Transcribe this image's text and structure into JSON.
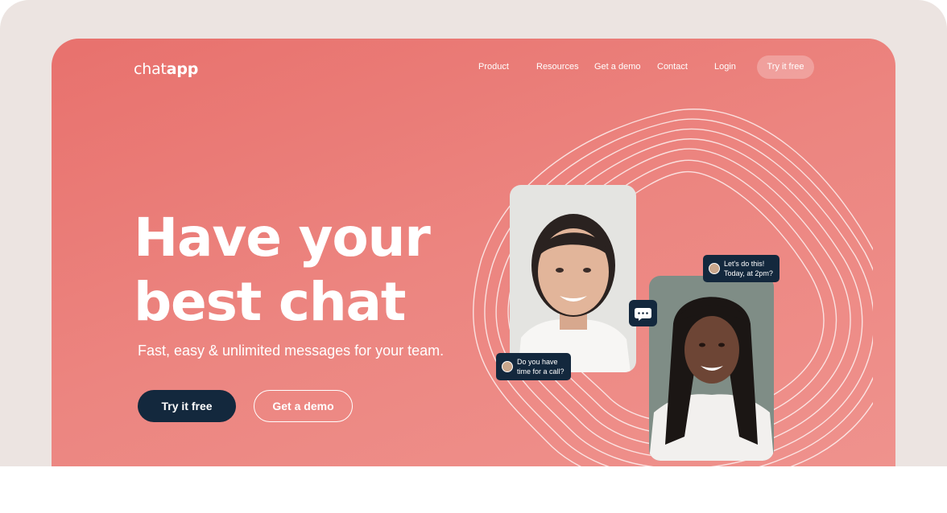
{
  "logo": {
    "light": "chat",
    "bold": "app"
  },
  "nav": {
    "items": [
      "Product",
      "Resources",
      "Get a demo",
      "Contact",
      "Login"
    ],
    "cta": "Try it free"
  },
  "hero": {
    "headline_line1": "Have your",
    "headline_line2": "best chat",
    "subline": "Fast, easy & unlimited messages for your team.",
    "primary_button": "Try it free",
    "secondary_button": "Get a demo"
  },
  "bubbles": {
    "top": {
      "line1": "Let's do this!",
      "line2": "Today, at 2pm?"
    },
    "bottom": {
      "line1": "Do you have",
      "line2": "time for a call?"
    }
  },
  "icons": [
    "chat-bubble-icon",
    "avatar"
  ],
  "colors": {
    "hero": "#e9736e",
    "navy": "#13283d",
    "text": "#ffffff"
  }
}
